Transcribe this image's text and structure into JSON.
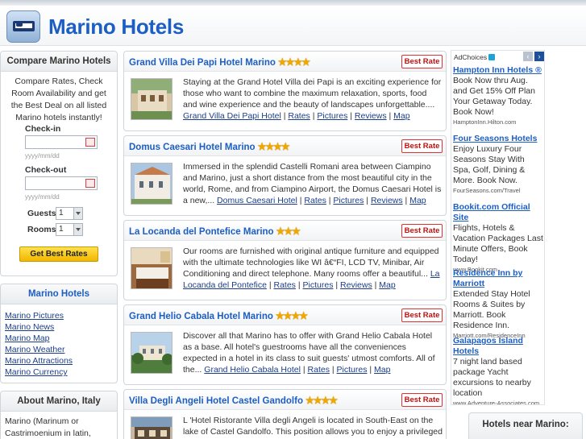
{
  "header": {
    "title": "Marino Hotels",
    "logo_icon": "bed-icon"
  },
  "compare": {
    "title": "Compare Marino Hotels",
    "intro": "Compare Rates, Check Room Availability and get the Best Deal on all listed Marino hotels instantly!",
    "checkin_label": "Check-in",
    "checkout_label": "Check-out",
    "date_hint": "yyyy/mm/dd",
    "guests_label": "Guests",
    "guests_value": "1",
    "rooms_label": "Rooms",
    "rooms_value": "1",
    "button": "Get Best Rates"
  },
  "marino_links": {
    "title": "Marino Hotels",
    "items": [
      "Marino Pictures",
      "Marino News",
      "Marino Map",
      "Marino Weather",
      "Marino Attractions",
      "Marino Currency"
    ]
  },
  "about": {
    "title": "About Marino, Italy",
    "text": "Marino (Marinum or Castrimoenium in latin, Marini in"
  },
  "best_rate_label": "Best Rate",
  "link_separator": "|",
  "hotels": [
    {
      "name": "Grand Villa Dei Papi Hotel Marino",
      "stars": "★★★★",
      "description": "Staying at the Grand Hotel Villa dei Papi is an exciting experience for those who want to combine the maximum relaxation, sports, food and wine experience and the beauty of landscapes unforgettable....",
      "links": [
        "Grand Villa Dei Papi Hotel",
        "Rates",
        "Pictures",
        "Reviews",
        "Map"
      ]
    },
    {
      "name": "Domus Caesari Hotel Marino",
      "stars": "★★★★",
      "description": "Immersed in the splendid Castelli Romani area between Ciampino and Marino, just a short distance from the most beautiful city in the world, Rome, and from Ciampino Airport, the Domus Caesari Hotel is a new,...",
      "links": [
        "Domus Caesari Hotel",
        "Rates",
        "Pictures",
        "Reviews",
        "Map"
      ]
    },
    {
      "name": "La Locanda del Pontefice Marino",
      "stars": "★★★",
      "description": "Our rooms are furnished with original antique furniture and equipped with the ultimate technologies like WI â€“FI, LCD TV, Minibar, Air Conditioning and direct telephone. Many rooms offer a beautiful...",
      "links": [
        "La Locanda del Pontefice",
        "Rates",
        "Pictures",
        "Reviews",
        "Map"
      ]
    },
    {
      "name": "Grand Helio Cabala Hotel Marino",
      "stars": "★★★★",
      "description": "Discover all that Marino has to offer with Grand Helio Cabala Hotel as a base. All hotel's guestrooms have all the conveniences expected in a hotel in its class to suit guests' utmost comforts. All of the...",
      "links": [
        "Grand Helio Cabala Hotel",
        "Rates",
        "Pictures",
        "Map"
      ]
    },
    {
      "name": "Villa Degli Angeli Hotel Castel Gandolfo",
      "stars": "★★★★",
      "description": "L 'Hotel Ristorante Villa degli Angeli is located in South-East on the lake of Castel Gandolfo. This position allows you to enjoy a privileged view, is",
      "links": []
    }
  ],
  "ads": {
    "adchoices": "AdChoices",
    "items": [
      {
        "title": "Hampton Inn Hotels ®",
        "body": "Book Now thru Aug. and Get 15% Off Plan Your Getaway Today. Book Now!",
        "url": "HamptonInn.Hilton.com"
      },
      {
        "title": "Four Seasons Hotels",
        "body": "Enjoy Luxury Four Seasons Stay With Spa, Golf, Dining & More. Book Now.",
        "url": "FourSeasons.com/Travel"
      },
      {
        "title": "Bookit.com Official Site",
        "body": "Flights, Hotels & Vacation Packages Last Minute Offers, Book Today!",
        "url": "www.Bookit.com"
      },
      {
        "title": "Residence Inn by Marriott",
        "body": "Extended Stay Hotel Rooms & Suites by Marriott. Book Residence Inn.",
        "url": "Marriott.com/ResidenceInn"
      },
      {
        "title": "Galapagos Island Hotels",
        "body": "7 night land based package Yacht excursions to nearby location",
        "url": "www.Adventure-Associates.com"
      }
    ]
  },
  "hotels_near": {
    "title": "Hotels near Marino:"
  }
}
